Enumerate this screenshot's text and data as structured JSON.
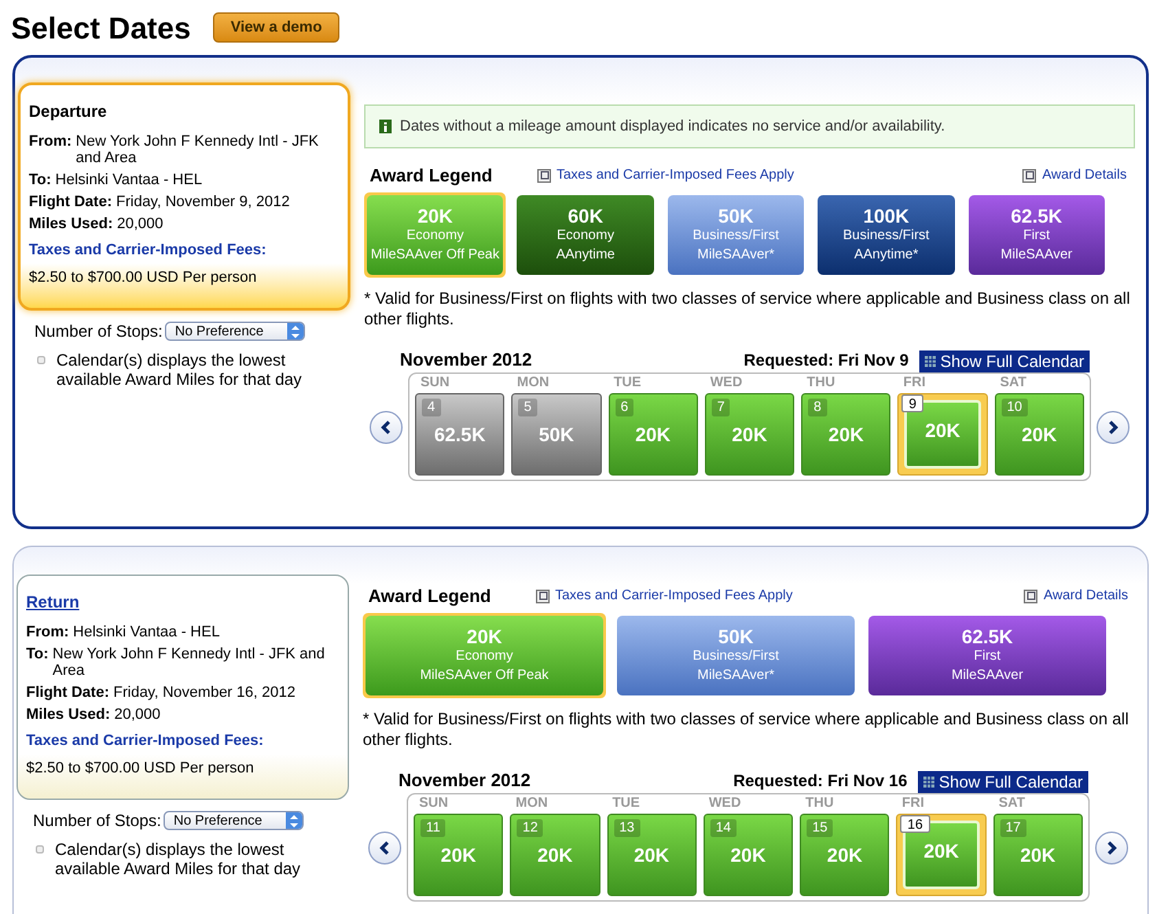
{
  "page_title": "Select Dates",
  "demo_button": "View a demo",
  "sections": [
    {
      "active": true,
      "heading": "Departure",
      "details": [
        {
          "label": "From:",
          "value": "New York John F Kennedy Intl - JFK and Area"
        },
        {
          "label": "To:",
          "value": "Helsinki Vantaa - HEL"
        },
        {
          "label": "Flight Date:",
          "value": "Friday, November 9, 2012"
        },
        {
          "label": "Miles Used:",
          "value": "20,000"
        }
      ],
      "fees_label": "Taxes and Carrier-Imposed Fees:",
      "fees_value": "$2.50 to $700.00 USD Per person",
      "stops_label": "Number of Stops:",
      "stops_value": "No Preference",
      "calendar_note": "Calendar(s) displays the lowest available Award Miles for that day",
      "info": "Dates without a mileage amount displayed indicates no service and/or availability.",
      "legend_title": "Award Legend",
      "fees_link": "Taxes and Carrier-Imposed Fees Apply",
      "details_link": "Award Details",
      "legend": [
        {
          "kind": "economy_offpeak",
          "selected": true,
          "miles": "20K",
          "line1": "Economy",
          "line2": "MileSAAver Off Peak"
        },
        {
          "kind": "economy_anytime",
          "selected": false,
          "miles": "60K",
          "line1": "Economy",
          "line2": "AAnytime"
        },
        {
          "kind": "business_saver",
          "selected": false,
          "miles": "50K",
          "line1": "Business/First",
          "line2": "MileSAAver*"
        },
        {
          "kind": "business_anytime",
          "selected": false,
          "miles": "100K",
          "line1": "Business/First",
          "line2": "AAnytime*"
        },
        {
          "kind": "first_saver",
          "selected": false,
          "miles": "62.5K",
          "line1": "First",
          "line2": "MileSAAver"
        }
      ],
      "footnote": "* Valid for Business/First on flights with two classes of service where applicable and Business class on all other flights.",
      "month": "November 2012",
      "requested": "Requested: Fri Nov 9",
      "full_calendar": "Show Full Calendar",
      "days": [
        {
          "weekday": "SUN",
          "day": "4",
          "miles": "62.5K",
          "kind": "other",
          "selected": false
        },
        {
          "weekday": "MON",
          "day": "5",
          "miles": "50K",
          "kind": "other",
          "selected": false
        },
        {
          "weekday": "TUE",
          "day": "6",
          "miles": "20K",
          "kind": "offpeak",
          "selected": false
        },
        {
          "weekday": "WED",
          "day": "7",
          "miles": "20K",
          "kind": "offpeak",
          "selected": false
        },
        {
          "weekday": "THU",
          "day": "8",
          "miles": "20K",
          "kind": "offpeak",
          "selected": false
        },
        {
          "weekday": "FRI",
          "day": "9",
          "miles": "20K",
          "kind": "offpeak",
          "selected": true
        },
        {
          "weekday": "SAT",
          "day": "10",
          "miles": "20K",
          "kind": "offpeak",
          "selected": false
        }
      ]
    },
    {
      "active": false,
      "heading": "Return",
      "details": [
        {
          "label": "From:",
          "value": "Helsinki Vantaa - HEL"
        },
        {
          "label": "To:",
          "value": "New York John F Kennedy Intl - JFK and Area"
        },
        {
          "label": "Flight Date:",
          "value": "Friday, November 16, 2012"
        },
        {
          "label": "Miles Used:",
          "value": "20,000"
        }
      ],
      "fees_label": "Taxes and Carrier-Imposed Fees:",
      "fees_value": "$2.50 to $700.00 USD Per person",
      "stops_label": "Number of Stops:",
      "stops_value": "No Preference",
      "calendar_note": "Calendar(s) displays the lowest available Award Miles for that day",
      "legend_title": "Award Legend",
      "fees_link": "Taxes and Carrier-Imposed Fees Apply",
      "details_link": "Award Details",
      "legend": [
        {
          "kind": "economy_offpeak",
          "selected": true,
          "miles": "20K",
          "line1": "Economy",
          "line2": "MileSAAver Off Peak"
        },
        {
          "kind": "business_saver",
          "selected": false,
          "miles": "50K",
          "line1": "Business/First",
          "line2": "MileSAAver*"
        },
        {
          "kind": "first_saver",
          "selected": false,
          "miles": "62.5K",
          "line1": "First",
          "line2": "MileSAAver"
        }
      ],
      "footnote": "* Valid for Business/First on flights with two classes of service where applicable and Business class on all other flights.",
      "month": "November 2012",
      "requested": "Requested: Fri Nov 16",
      "full_calendar": "Show Full Calendar",
      "days": [
        {
          "weekday": "SUN",
          "day": "11",
          "miles": "20K",
          "kind": "offpeak",
          "selected": false
        },
        {
          "weekday": "MON",
          "day": "12",
          "miles": "20K",
          "kind": "offpeak",
          "selected": false
        },
        {
          "weekday": "TUE",
          "day": "13",
          "miles": "20K",
          "kind": "offpeak",
          "selected": false
        },
        {
          "weekday": "WED",
          "day": "14",
          "miles": "20K",
          "kind": "offpeak",
          "selected": false
        },
        {
          "weekday": "THU",
          "day": "15",
          "miles": "20K",
          "kind": "offpeak",
          "selected": false
        },
        {
          "weekday": "FRI",
          "day": "16",
          "miles": "20K",
          "kind": "offpeak",
          "selected": true
        },
        {
          "weekday": "SAT",
          "day": "17",
          "miles": "20K",
          "kind": "offpeak",
          "selected": false
        }
      ]
    }
  ]
}
